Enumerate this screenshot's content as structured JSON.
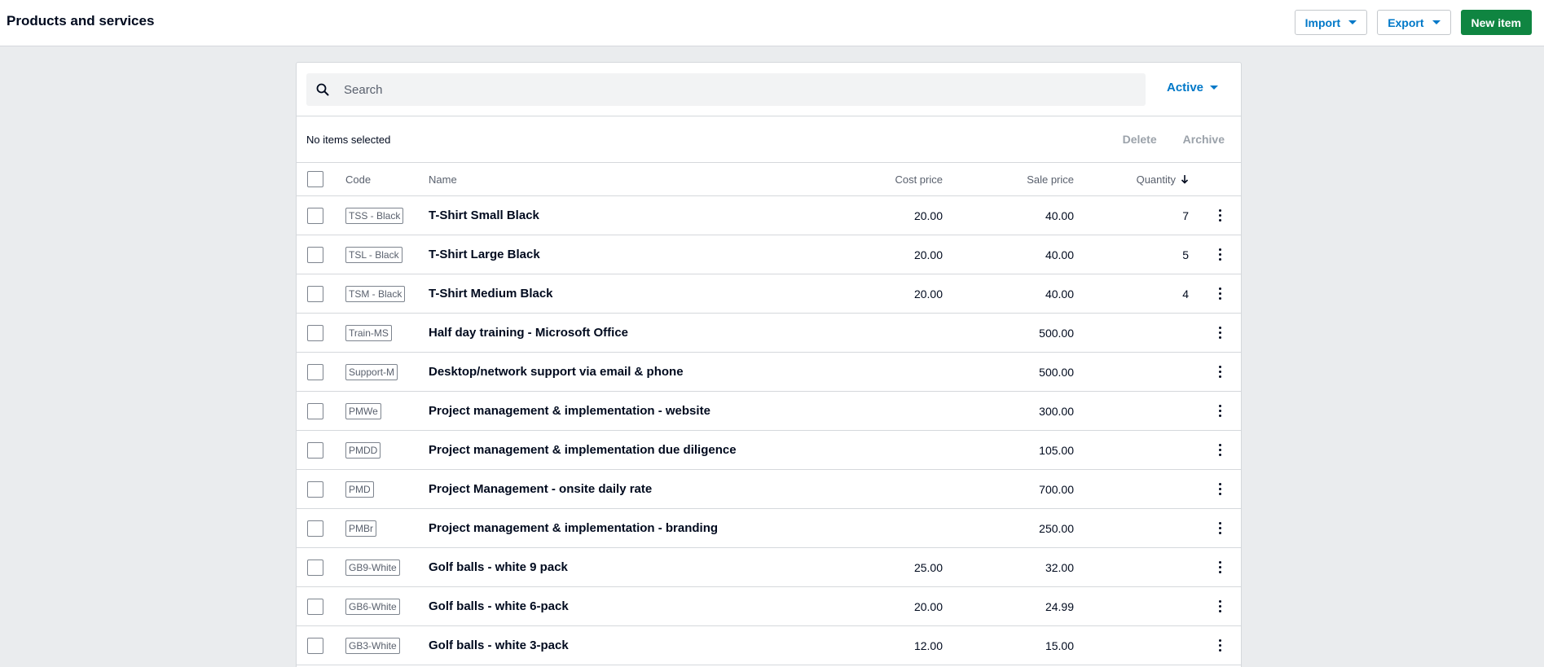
{
  "header": {
    "title": "Products and services",
    "import_label": "Import",
    "export_label": "Export",
    "new_item_label": "New item"
  },
  "search": {
    "placeholder": "Search",
    "filter_label": "Active"
  },
  "bulk": {
    "status": "No items selected",
    "delete_label": "Delete",
    "archive_label": "Archive"
  },
  "table": {
    "columns": {
      "code": "Code",
      "name": "Name",
      "cost": "Cost price",
      "sale": "Sale price",
      "quantity": "Quantity"
    },
    "rows": [
      {
        "code": "TSS - Black",
        "name": "T-Shirt Small Black",
        "cost": "20.00",
        "sale": "40.00",
        "qty": "7"
      },
      {
        "code": "TSL - Black",
        "name": "T-Shirt Large Black",
        "cost": "20.00",
        "sale": "40.00",
        "qty": "5"
      },
      {
        "code": "TSM - Black",
        "name": "T-Shirt Medium Black",
        "cost": "20.00",
        "sale": "40.00",
        "qty": "4"
      },
      {
        "code": "Train-MS",
        "name": "Half day training - Microsoft Office",
        "cost": "",
        "sale": "500.00",
        "qty": ""
      },
      {
        "code": "Support-M",
        "name": "Desktop/network support via email & phone",
        "cost": "",
        "sale": "500.00",
        "qty": ""
      },
      {
        "code": "PMWe",
        "name": "Project management & implementation - website",
        "cost": "",
        "sale": "300.00",
        "qty": ""
      },
      {
        "code": "PMDD",
        "name": "Project management & implementation due diligence",
        "cost": "",
        "sale": "105.00",
        "qty": ""
      },
      {
        "code": "PMD",
        "name": "Project Management - onsite daily rate",
        "cost": "",
        "sale": "700.00",
        "qty": ""
      },
      {
        "code": "PMBr",
        "name": "Project management & implementation - branding",
        "cost": "",
        "sale": "250.00",
        "qty": ""
      },
      {
        "code": "GB9-White",
        "name": "Golf balls - white 9 pack",
        "cost": "25.00",
        "sale": "32.00",
        "qty": ""
      },
      {
        "code": "GB6-White",
        "name": "Golf balls - white 6-pack",
        "cost": "20.00",
        "sale": "24.99",
        "qty": ""
      },
      {
        "code": "GB3-White",
        "name": "Golf balls - white 3-pack",
        "cost": "12.00",
        "sale": "15.00",
        "qty": ""
      }
    ]
  },
  "colors": {
    "accent": "#0078c8",
    "primary_button": "#0f8541",
    "page_background": "#eaecee"
  }
}
